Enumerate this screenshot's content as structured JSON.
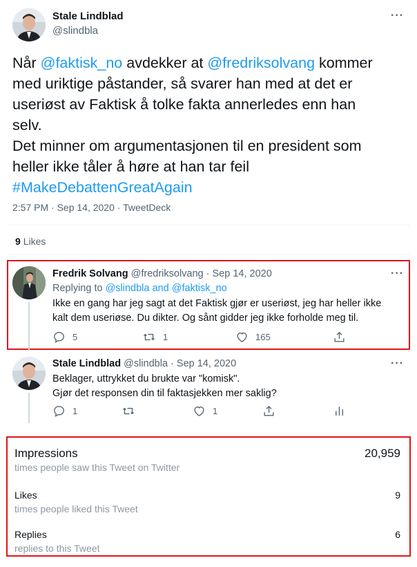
{
  "main_tweet": {
    "author_name": "Stale Lindblad",
    "author_handle": "@slindbla",
    "text_lines": [
      [
        {
          "t": "Når ",
          "c": "text"
        },
        {
          "t": "@faktisk_no",
          "c": "link"
        },
        {
          "t": " avdekker at ",
          "c": "text"
        },
        {
          "t": "@fredriksolvang",
          "c": "link"
        },
        {
          "t": " kommer",
          "c": "text"
        }
      ],
      [
        {
          "t": "med uriktige påstander, så svarer han med at det er",
          "c": "text"
        }
      ],
      [
        {
          "t": "useriøst av Faktisk å tolke fakta annerledes enn han",
          "c": "text"
        }
      ],
      [
        {
          "t": "selv.",
          "c": "text"
        }
      ],
      [
        {
          "t": "Det minner om argumentasjonen til en president som",
          "c": "text"
        }
      ],
      [
        {
          "t": "heller ikke tåler å høre at han tar feil",
          "c": "text"
        }
      ],
      [
        {
          "t": "#MakeDebattenGreatAgain",
          "c": "link"
        }
      ]
    ],
    "meta": "2:57 PM · Sep 14, 2020 · TweetDeck",
    "likes_count": "9",
    "likes_label": "Likes"
  },
  "reply_1": {
    "author_name": "Fredrik Solvang",
    "header_rest": "@fredriksolvang · Sep 14, 2020",
    "replying_prefix": "Replying to ",
    "replying_targets": "@slindbla and @faktisk_no",
    "body_line_1": "Ikke en gang har jeg sagt at det Faktisk gjør er useriøst, jeg har heller ikke",
    "body_line_2": "kalt dem useriøse. Du dikter. Og sånt gidder jeg ikke forholde meg til.",
    "reply_count": "5",
    "retweet_count": "1",
    "like_count": "165"
  },
  "reply_2": {
    "author_name": "Stale Lindblad",
    "header_rest": "@slindbla · Sep 14, 2020",
    "body_line_1": "Beklager, uttrykket du brukte var \"komisk\".",
    "body_line_2": "Gjør det responsen din til faktasjekken mer saklig?",
    "reply_count": "1",
    "like_count": "1"
  },
  "stats": {
    "impressions_label": "Impressions",
    "impressions_sub": "times people saw this Tweet on Twitter",
    "impressions_value": "20,959",
    "likes_label": "Likes",
    "likes_sub": "times people liked this Tweet",
    "likes_value": "9",
    "replies_label": "Replies",
    "replies_sub": "replies to this Tweet",
    "replies_value": "6"
  },
  "colors": {
    "link": "#1d9bf0",
    "muted": "#536471",
    "highlight_border": "#e0151b"
  }
}
